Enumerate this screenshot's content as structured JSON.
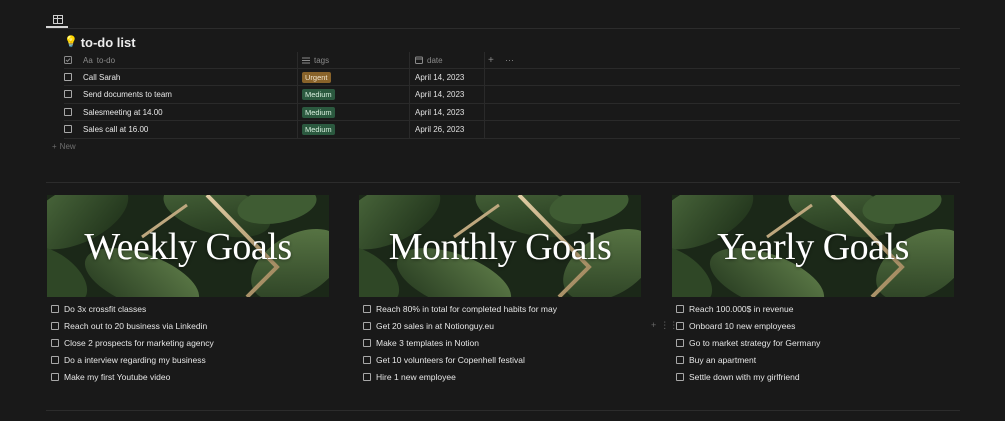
{
  "database": {
    "title_icon": "lightbulb-icon",
    "title": "to-do list",
    "columns": {
      "todo_prefix": "Aa",
      "todo": "to-do",
      "tags": "tags",
      "date": "date",
      "add": "+",
      "more": "···"
    },
    "rows": [
      {
        "todo": "Call Sarah",
        "tag": "Urgent",
        "tag_color": "#89632a",
        "date": "April 14, 2023"
      },
      {
        "todo": "Send documents to team",
        "tag": "Medium",
        "tag_color": "#2b593f",
        "date": "April 14, 2023"
      },
      {
        "todo": "Salesmeeting at 14.00",
        "tag": "Medium",
        "tag_color": "#2b593f",
        "date": "April 14, 2023"
      },
      {
        "todo": "Sales call at 16.00",
        "tag": "Medium",
        "tag_color": "#2b593f",
        "date": "April 26, 2023"
      }
    ],
    "new_label": "New"
  },
  "goals": [
    {
      "banner_title": "Weekly Goals",
      "items": [
        "Do 3x crossfit classes",
        "Reach out to 20 business via Linkedin",
        "Close 2 prospects for marketing agency",
        "Do a interview regarding my business",
        "Make my first Youtube video"
      ]
    },
    {
      "banner_title": "Monthly Goals",
      "items": [
        "Reach 80% in total for completed habits for may",
        "Get 20 sales in at Notionguy.eu",
        "Make 3 templates in Notion",
        "Get 10 volunteers for Copenhell festival",
        "Hire 1 new employee"
      ]
    },
    {
      "banner_title": "Yearly Goals",
      "items": [
        "Reach 100.000$ in revenue",
        "Onboard 10 new employees",
        "Go to market strategy for Germany",
        "Buy an apartment",
        "Settle down with my girlfriend"
      ]
    }
  ],
  "colors": {
    "background": "#191919",
    "tag_urgent": "#89632a",
    "tag_medium": "#2b593f",
    "banner_gold_line": "#c9b08a"
  }
}
